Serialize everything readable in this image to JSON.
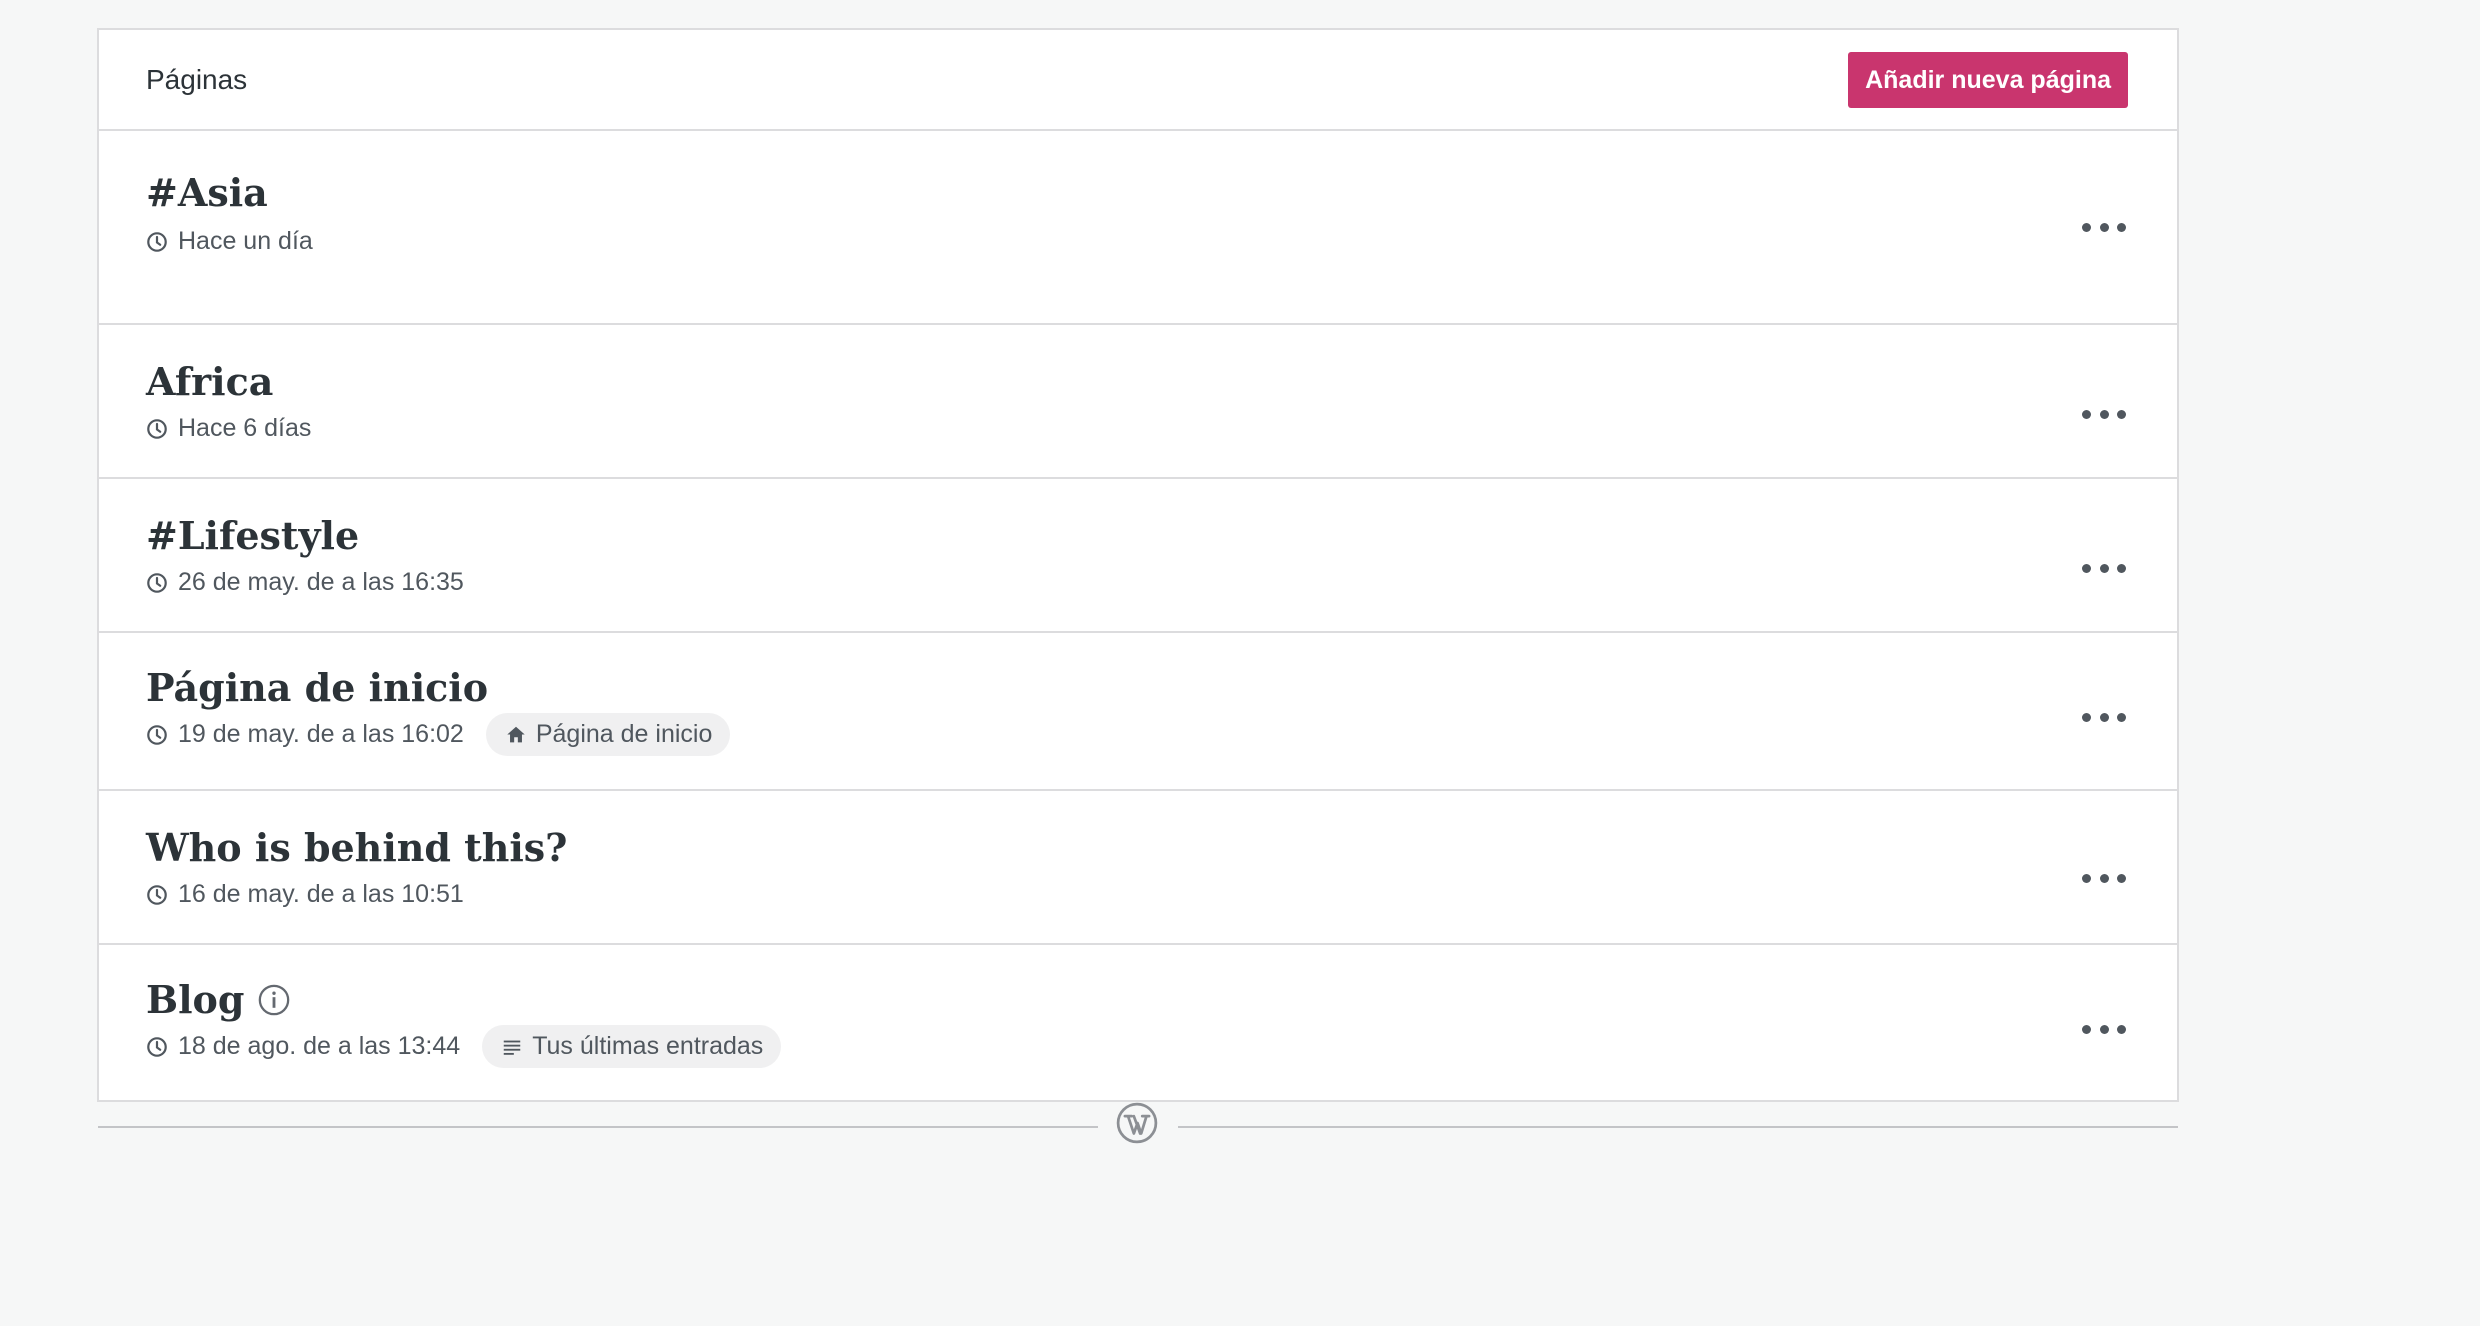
{
  "header": {
    "title": "Páginas",
    "add_button_label": "Añadir nueva página"
  },
  "pages": [
    {
      "title": "#Asia",
      "date": "Hace un día",
      "badge": null,
      "info": false
    },
    {
      "title": "Africa",
      "date": "Hace 6 días",
      "badge": null,
      "info": false
    },
    {
      "title": "#Lifestyle",
      "date": "26 de may. de a las 16:35",
      "badge": null,
      "info": false
    },
    {
      "title": "Página de inicio",
      "date": "19 de may. de a las 16:02",
      "badge": {
        "label": "Página de inicio",
        "icon": "home-icon"
      },
      "info": false
    },
    {
      "title": "Who is behind this?",
      "date": "16 de may. de a las 10:51",
      "badge": null,
      "info": false
    },
    {
      "title": "Blog",
      "date": "18 de ago. de a las 13:44",
      "badge": {
        "label": "Tus últimas entradas",
        "icon": "posts-list-icon"
      },
      "info": true
    }
  ],
  "colors": {
    "accent": "#c9356e",
    "background": "#f6f7f7",
    "border": "#dcdcde",
    "text": "#2c3338",
    "muted": "#50575e"
  },
  "icons": {
    "row_menu": "more-horizontal-icon",
    "date": "clock-icon",
    "info": "info-icon",
    "footer": "wordpress-logo-icon"
  }
}
